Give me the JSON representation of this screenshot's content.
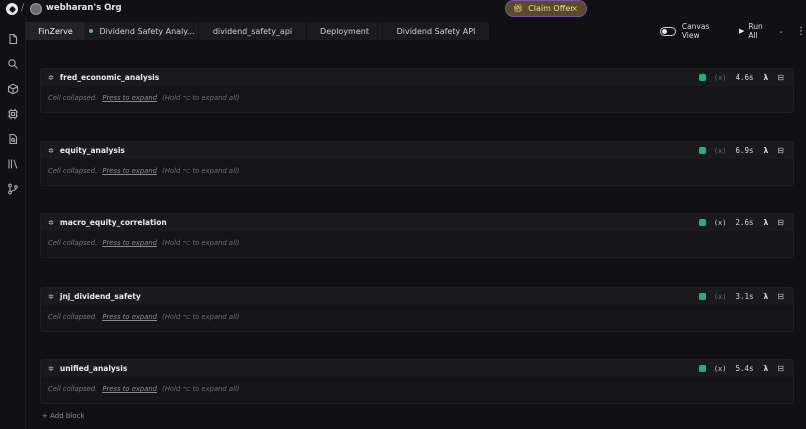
{
  "org": {
    "name": "webharan's Org"
  },
  "offer": {
    "label": "Claim Offer"
  },
  "tabs": [
    {
      "label": "FinZerve",
      "active": true,
      "dot": false
    },
    {
      "label": "Dividend Safety Analy...",
      "active": false,
      "dot": true
    },
    {
      "label": "dividend_safety_api",
      "active": false,
      "dot": false
    },
    {
      "label": "Deployment",
      "active": false,
      "dot": false
    },
    {
      "label": "Dividend Safety API",
      "active": false,
      "dot": false
    }
  ],
  "toolbar": {
    "canvas_view": "Canvas View",
    "run_all": "Run All"
  },
  "cells": [
    {
      "name": "fred_economic_analysis",
      "vars": "(x)",
      "vars_on": false,
      "time": "4.6s",
      "lambda": "λ"
    },
    {
      "name": "equity_analysis",
      "vars": "(x)",
      "vars_on": false,
      "time": "6.9s",
      "lambda": "λ"
    },
    {
      "name": "macro_equity_correlation",
      "vars": "(x)",
      "vars_on": true,
      "time": "2.6s",
      "lambda": "λ"
    },
    {
      "name": "jnj_dividend_safety",
      "vars": "(x)",
      "vars_on": false,
      "time": "3.1s",
      "lambda": "λ"
    },
    {
      "name": "unified_analysis",
      "vars": "(x)",
      "vars_on": true,
      "time": "5.4s",
      "lambda": "λ"
    }
  ],
  "cell_body": {
    "collapsed": "Cell collapsed.",
    "expand": "Press to expand",
    "hint": "(Hold ⌥ to expand all)"
  },
  "footer": {
    "add_block": "+ Add block"
  },
  "colors": {
    "status_ok": "#23b26b",
    "accent": "#7a4fb5"
  }
}
